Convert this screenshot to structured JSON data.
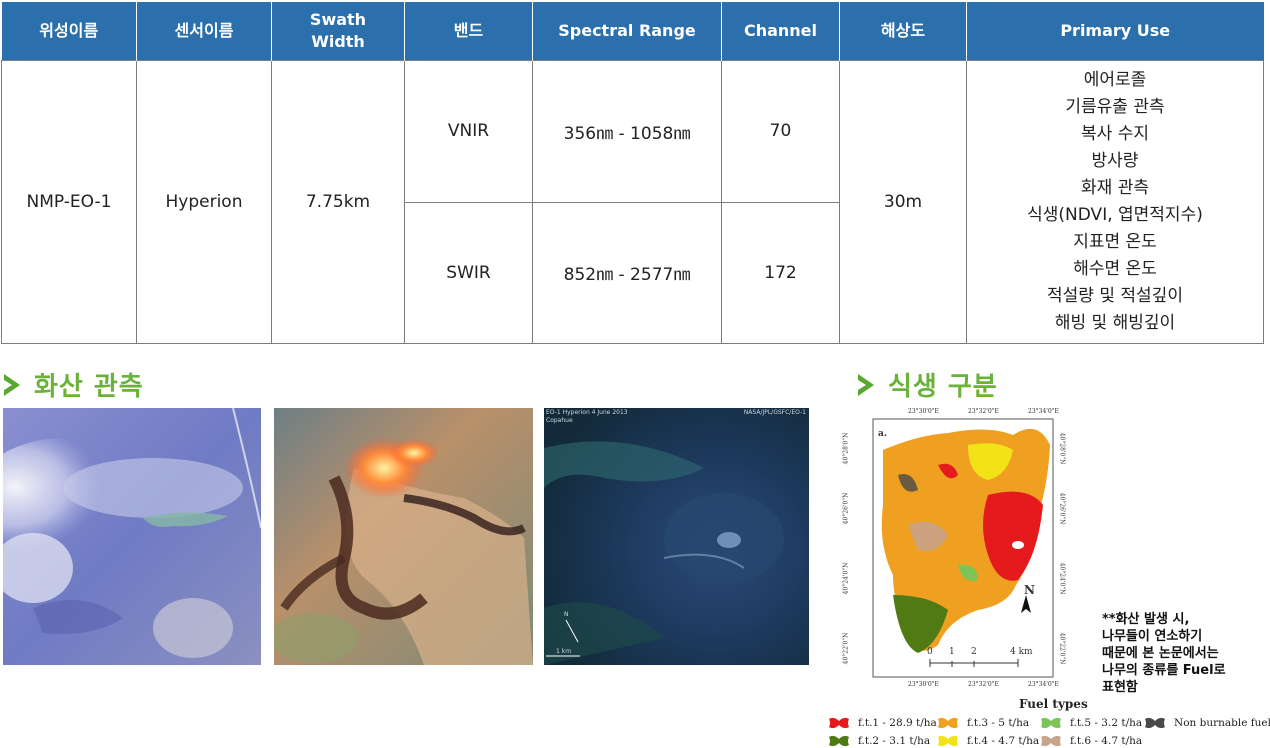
{
  "table": {
    "headers": [
      "위성이름",
      "센서이름",
      "Swath\nWidth",
      "밴드",
      "Spectral Range",
      "Channel",
      "해상도",
      "Primary Use"
    ],
    "satellite": "NMP-EO-1",
    "sensor": "Hyperion",
    "swath": "7.75km",
    "resolution": "30m",
    "bands": [
      {
        "name": "VNIR",
        "range": "356㎚ - 1058㎚",
        "channel": "70"
      },
      {
        "name": "SWIR",
        "range": "852㎚ - 2577㎚",
        "channel": "172"
      }
    ],
    "uses": [
      "에어로졸",
      "기름유출 관측",
      "복사 수지",
      "방사량",
      "화재 관측",
      "식생(NDVI, 엽면적지수)",
      "지표면 온도",
      "해수면 온도",
      "적설량 및 적설깊이",
      "해빙 및 해빙깊이"
    ]
  },
  "sections": {
    "volcano_title": "화산 관측",
    "vegetation_title": "식생 구분"
  },
  "photos": {
    "third_caption_left": "EO-1 Hyperion 4 June 2013",
    "third_caption_left2": "Copahue",
    "third_caption_right": "NASA/JPL/GSFC/EO-1",
    "third_north": "N",
    "third_scale": "1 km"
  },
  "map": {
    "panel_label": "a.",
    "top_ticks": [
      "23°30'0\"E",
      "23°32'0\"E",
      "23°34'0\"E"
    ],
    "bottom_ticks": [
      "23°30'0\"E",
      "23°32'0\"E",
      "23°34'0\"E"
    ],
    "left_ticks": [
      "40°28'0\"N",
      "40°26'0\"N",
      "40°24'0\"N",
      "40°22'0\"N"
    ],
    "right_ticks": [
      "40°28'0\"N",
      "40°26'0\"N",
      "40°24'0\"N",
      "40°22'0\"N"
    ],
    "north": "N",
    "scale_labels": [
      "0",
      "1",
      "2",
      "4 km"
    ]
  },
  "note": [
    "**화산 발생 시,",
    "나무들이 연소하기",
    "때문에 본 논문에서는",
    "나무의 종류를 Fuel로",
    "표현함"
  ],
  "legend": {
    "title": "Fuel types",
    "items": [
      {
        "label": "f.t.1 - 28.9 t/ha",
        "color": "#e41a1c"
      },
      {
        "label": "f.t.3 - 5 t/ha",
        "color": "#f0a020"
      },
      {
        "label": "f.t.5 - 3.2  t/ha",
        "color": "#7cc457"
      },
      {
        "label": "Non burnable fuels",
        "color": "#4a4a4a"
      },
      {
        "label": "f.t.2 - 3.1 t/ha",
        "color": "#4f7a14"
      },
      {
        "label": "f.t.4 - 4.7 t/ha",
        "color": "#f2e318"
      },
      {
        "label": "f.t.6 - 4.7  t/ha",
        "color": "#c9a38a"
      }
    ]
  }
}
